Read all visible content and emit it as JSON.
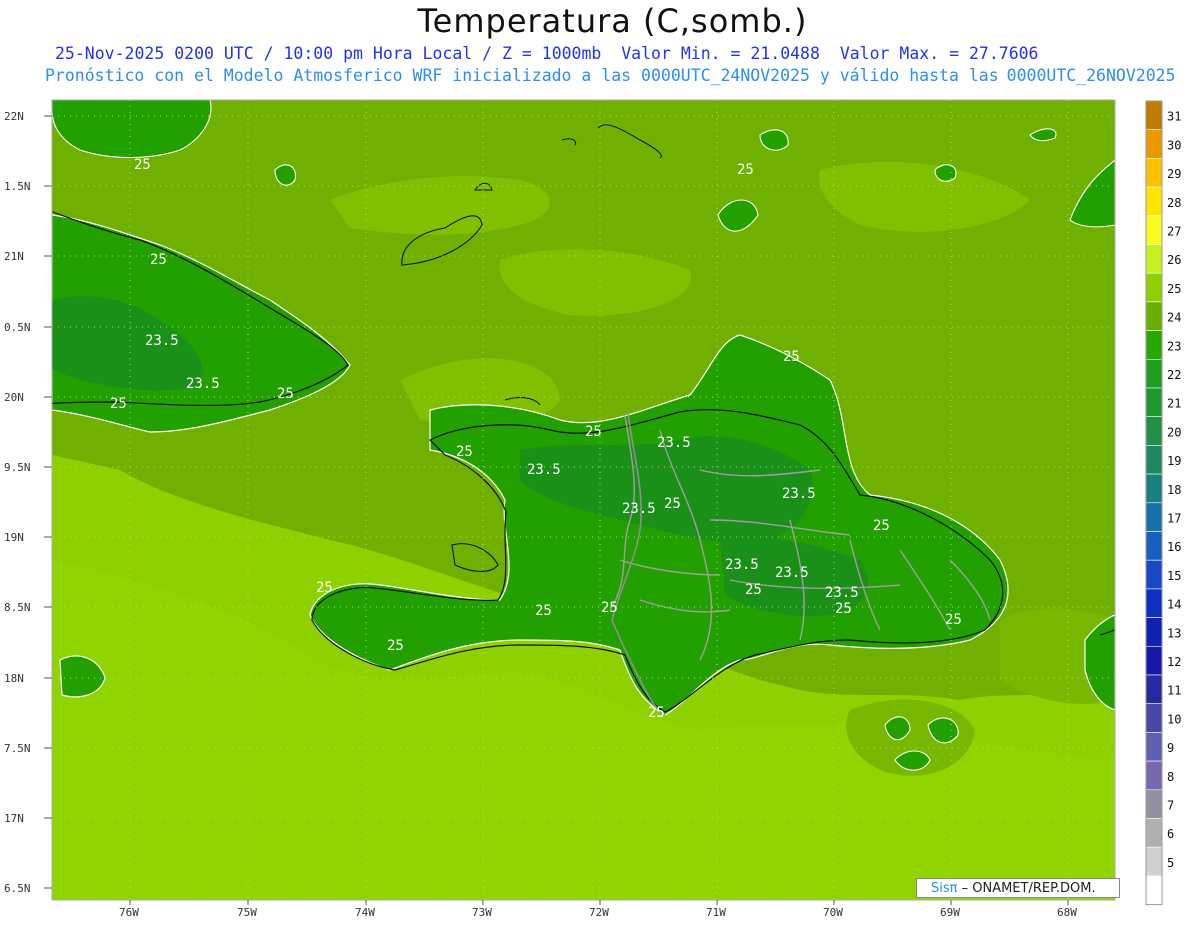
{
  "header": {
    "title": "Temperatura (C,somb.)",
    "date_line": "25-Nov-2025 0200 UTC / 10:00 pm Hora Local / Z = 1000mb",
    "min_label": "Valor Min. = 21.0488",
    "max_label": "Valor Max. = 27.7606",
    "model_line_a": "Pronóstico con el Modelo Atmosferico WRF inicializado a las 0000UTC_24NOV2025 y válido hasta las",
    "model_line_b": "0000UTC_26NOV2025"
  },
  "axes": {
    "lat_labels": [
      "22N",
      "1.5N",
      "21N",
      "0.5N",
      "20N",
      "9.5N",
      "19N",
      "8.5N",
      "18N",
      "7.5N",
      "17N",
      "6.5N"
    ],
    "lon_labels": [
      "76W",
      "75W",
      "74W",
      "73W",
      "72W",
      "71W",
      "70W",
      "69W",
      "68W"
    ]
  },
  "colorbar": {
    "ticks": [
      "31",
      "30",
      "29",
      "28",
      "27",
      "26",
      "25",
      "24",
      "23",
      "22",
      "21",
      "20",
      "19",
      "18",
      "17",
      "16",
      "15",
      "14",
      "13",
      "12",
      "11",
      "10",
      "9",
      "8",
      "7",
      "6",
      "5"
    ],
    "colors": [
      "#c07c00",
      "#e89a00",
      "#ffc000",
      "#ffe400",
      "#f8fc20",
      "#c8f020",
      "#90d000",
      "#68b000",
      "#28a800",
      "#20a020",
      "#209830",
      "#209048",
      "#208860",
      "#188080",
      "#1870a8",
      "#1860c0",
      "#1848c8",
      "#1030c0",
      "#1020b0",
      "#1818a8",
      "#2828a0",
      "#4848a8",
      "#6060b0",
      "#7868b0",
      "#9090a0",
      "#b0b0b0",
      "#d0d0d0",
      "#ffffff"
    ]
  },
  "contour_labels": [
    "25",
    "25",
    "25",
    "23.5",
    "23.5",
    "25",
    "25",
    "25",
    "25",
    "23.5",
    "25",
    "23.5",
    "23.5",
    "25",
    "25",
    "23.5",
    "23.5",
    "25",
    "23.5",
    "23.5",
    "25",
    "25",
    "25",
    "25",
    "25",
    "25",
    "25"
  ],
  "credit": {
    "brand": "Sisπ",
    "text": "– ONAMET/REP.DOM."
  }
}
